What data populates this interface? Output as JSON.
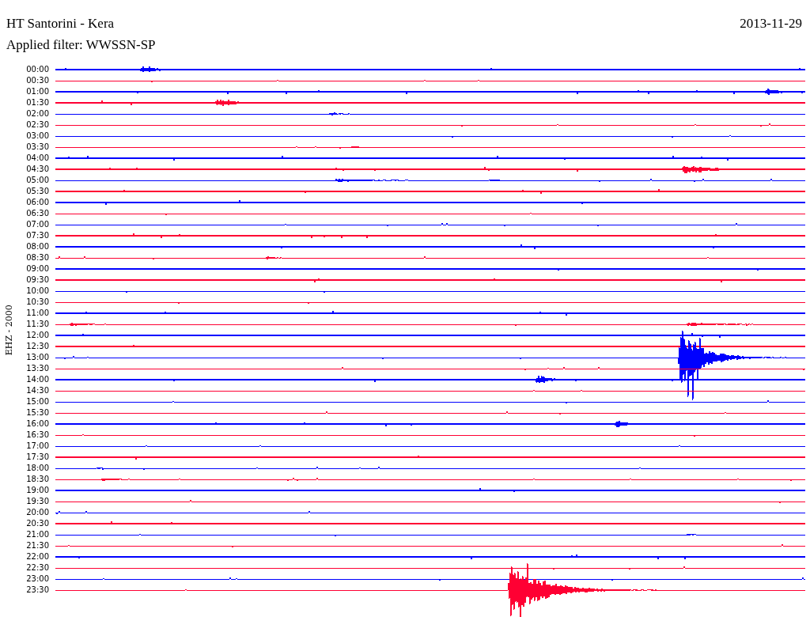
{
  "header": {
    "title": "HT Santorini - Kera",
    "date": "2013-11-29",
    "filter": "Applied filter: WWSSN-SP"
  },
  "channel_label": "EHZ - 2000",
  "rows": [
    {
      "label": "00:00",
      "color": "#0000ff"
    },
    {
      "label": "00:30",
      "color": "#ff0033"
    },
    {
      "label": "01:00",
      "color": "#0000ff"
    },
    {
      "label": "01:30",
      "color": "#ff0033"
    },
    {
      "label": "02:00",
      "color": "#0000ff"
    },
    {
      "label": "02:30",
      "color": "#ff0033"
    },
    {
      "label": "03:00",
      "color": "#0000ff"
    },
    {
      "label": "03:30",
      "color": "#ff0033"
    },
    {
      "label": "04:00",
      "color": "#0000ff"
    },
    {
      "label": "04:30",
      "color": "#ff0033"
    },
    {
      "label": "05:00",
      "color": "#0000ff"
    },
    {
      "label": "05:30",
      "color": "#ff0033"
    },
    {
      "label": "06:00",
      "color": "#0000ff"
    },
    {
      "label": "06:30",
      "color": "#ff0033"
    },
    {
      "label": "07:00",
      "color": "#0000ff"
    },
    {
      "label": "07:30",
      "color": "#ff0033"
    },
    {
      "label": "08:00",
      "color": "#0000ff"
    },
    {
      "label": "08:30",
      "color": "#ff0033"
    },
    {
      "label": "09:00",
      "color": "#0000ff"
    },
    {
      "label": "09:30",
      "color": "#ff0033"
    },
    {
      "label": "10:00",
      "color": "#0000ff"
    },
    {
      "label": "10:30",
      "color": "#ff0033"
    },
    {
      "label": "11:00",
      "color": "#0000ff"
    },
    {
      "label": "11:30",
      "color": "#ff0033"
    },
    {
      "label": "12:00",
      "color": "#0000ff"
    },
    {
      "label": "12:30",
      "color": "#ff0033"
    },
    {
      "label": "13:00",
      "color": "#0000ff"
    },
    {
      "label": "13:30",
      "color": "#ff0033"
    },
    {
      "label": "14:00",
      "color": "#0000ff"
    },
    {
      "label": "14:30",
      "color": "#ff0033"
    },
    {
      "label": "15:00",
      "color": "#0000ff"
    },
    {
      "label": "15:30",
      "color": "#ff0033"
    },
    {
      "label": "16:00",
      "color": "#0000ff"
    },
    {
      "label": "16:30",
      "color": "#ff0033"
    },
    {
      "label": "17:00",
      "color": "#0000ff"
    },
    {
      "label": "17:30",
      "color": "#ff0033"
    },
    {
      "label": "18:00",
      "color": "#0000ff"
    },
    {
      "label": "18:30",
      "color": "#ff0033"
    },
    {
      "label": "19:00",
      "color": "#0000ff"
    },
    {
      "label": "19:30",
      "color": "#ff0033"
    },
    {
      "label": "20:00",
      "color": "#0000ff"
    },
    {
      "label": "20:30",
      "color": "#ff0033"
    },
    {
      "label": "21:00",
      "color": "#0000ff"
    },
    {
      "label": "21:30",
      "color": "#ff0033"
    },
    {
      "label": "22:00",
      "color": "#0000ff"
    },
    {
      "label": "22:30",
      "color": "#ff0033"
    },
    {
      "label": "23:00",
      "color": "#0000ff"
    },
    {
      "label": "23:30",
      "color": "#ff0033"
    }
  ]
}
